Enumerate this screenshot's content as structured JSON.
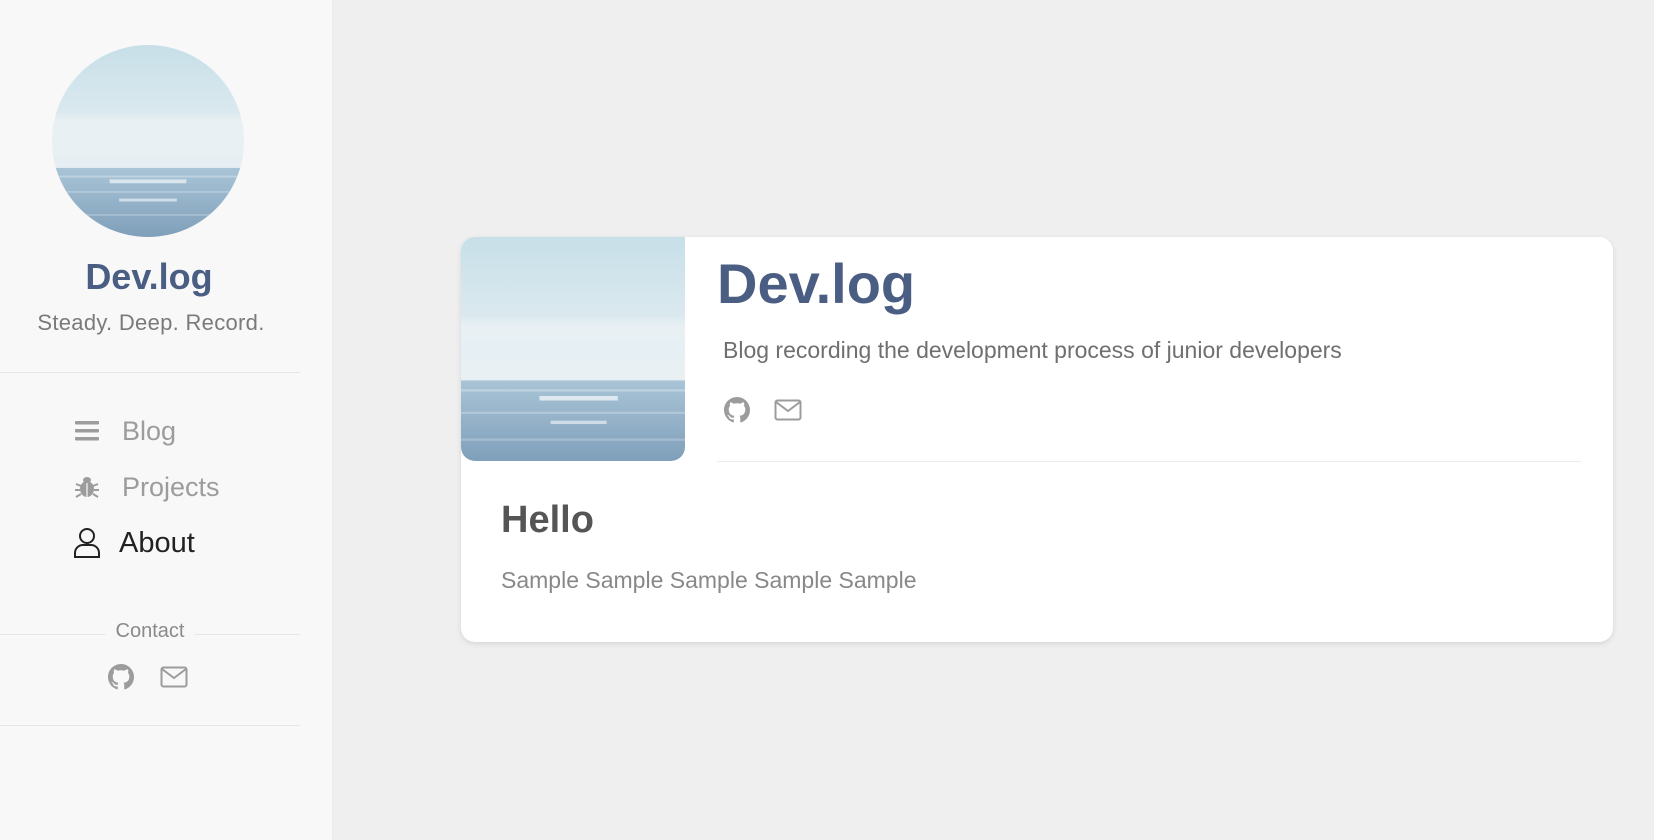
{
  "sidebar": {
    "title": "Dev.log",
    "tagline": "Steady. Deep. Record.",
    "nav": [
      {
        "label": "Blog",
        "icon": "list-icon"
      },
      {
        "label": "Projects",
        "icon": "bug-icon"
      },
      {
        "label": "About",
        "icon": "user-icon",
        "active": true
      }
    ],
    "contact_label": "Contact",
    "contact_icons": [
      "github-icon",
      "mail-icon"
    ]
  },
  "profile_card": {
    "title": "Dev.log",
    "description": "Blog recording the development process of junior developers",
    "icons": [
      "github-icon",
      "mail-icon"
    ]
  },
  "post": {
    "title": "Hello",
    "body": "Sample Sample Sample Sample Sample"
  },
  "colors": {
    "accent": "#4a5d82",
    "sidebar_bg": "#f8f8f8",
    "page_bg": "#efefef"
  }
}
